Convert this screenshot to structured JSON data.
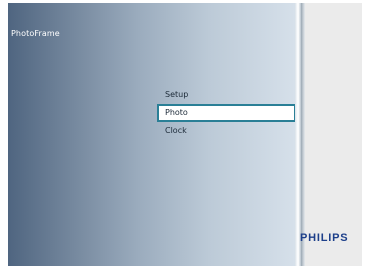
{
  "app": {
    "title": "PhotoFrame"
  },
  "menu": {
    "items": [
      {
        "label": "Setup",
        "selected": false
      },
      {
        "label": "Photo",
        "selected": true
      },
      {
        "label": "Clock",
        "selected": false
      }
    ]
  },
  "brand": {
    "logo_text": "PHILIPS",
    "color": "#1d3f8a"
  },
  "colors": {
    "selection_border": "#2a7f96",
    "panel_gradient_start": "#4f6580",
    "panel_gradient_end": "#d6e0ea"
  }
}
